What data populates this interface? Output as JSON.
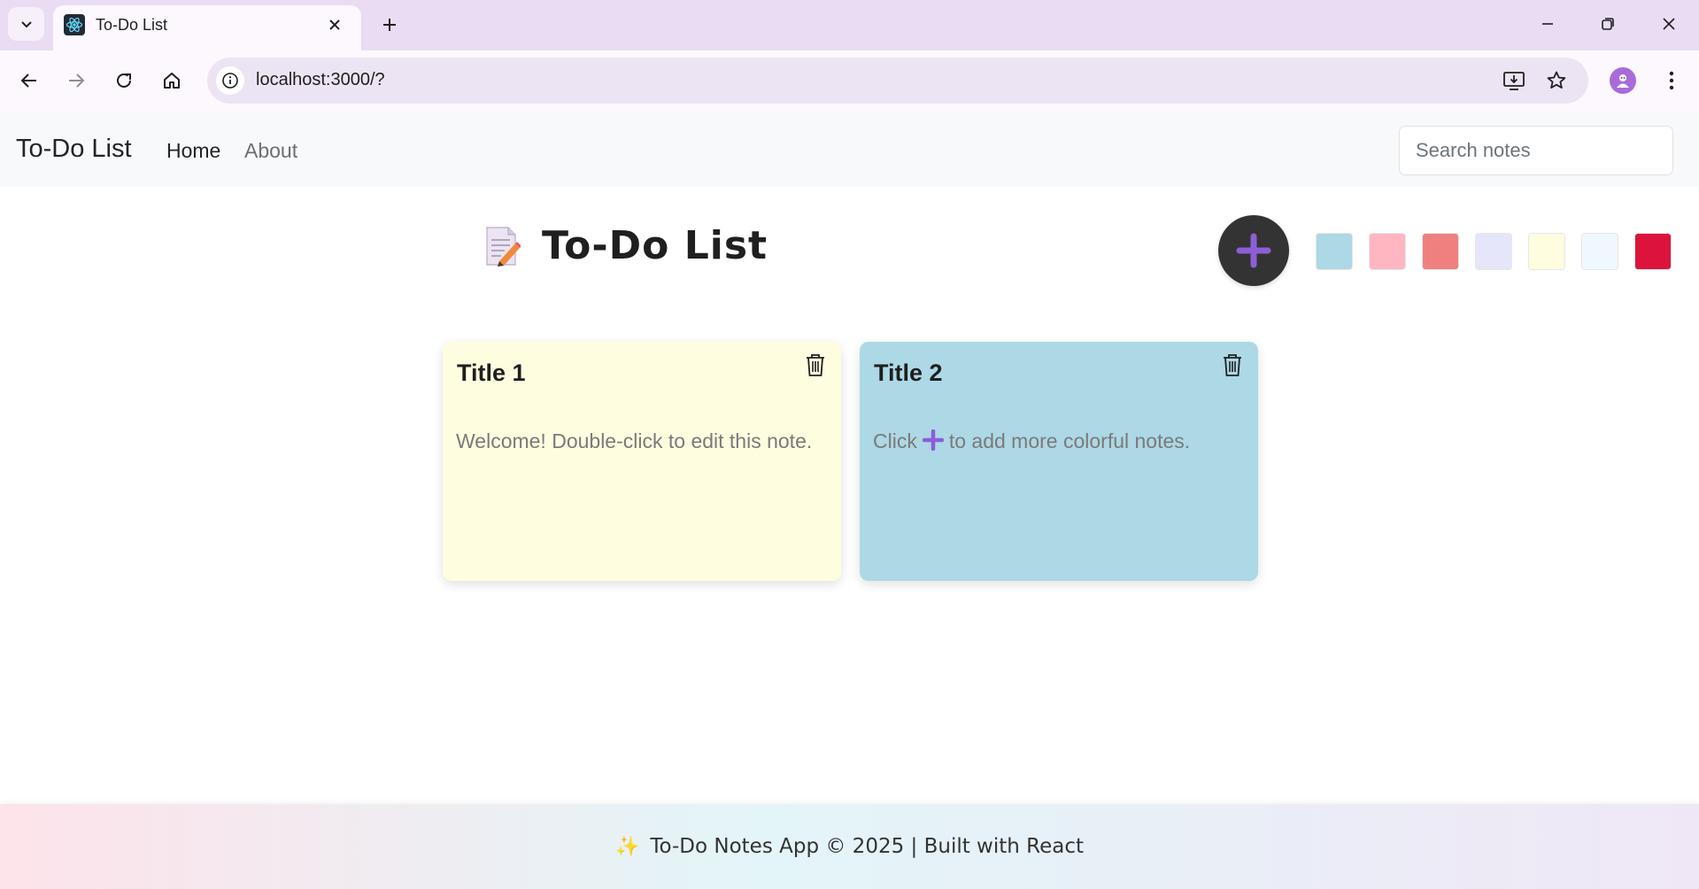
{
  "browser": {
    "tab_title": "To-Do List",
    "url": "localhost:3000/?"
  },
  "navbar": {
    "brand": "To-Do List",
    "links": [
      "Home",
      "About"
    ],
    "search_placeholder": "Search notes"
  },
  "header": {
    "title": "To-Do List",
    "add_button_icon": "plus-icon"
  },
  "color_palette": [
    "#add8e6",
    "#ffb6c1",
    "#f08080",
    "#e6e6fa",
    "#fffde0",
    "#f0f8ff",
    "#dc143c"
  ],
  "notes": [
    {
      "title": "Title 1",
      "body": "Welcome! Double-click to edit this note.",
      "color": "#fffde0"
    },
    {
      "title": "Title 2",
      "body_before": "Click",
      "body_after": "to add more colorful notes.",
      "color": "#add8e6"
    }
  ],
  "footer": {
    "sparkle": "✨",
    "text": "To-Do Notes App © 2025 | Built with React"
  }
}
